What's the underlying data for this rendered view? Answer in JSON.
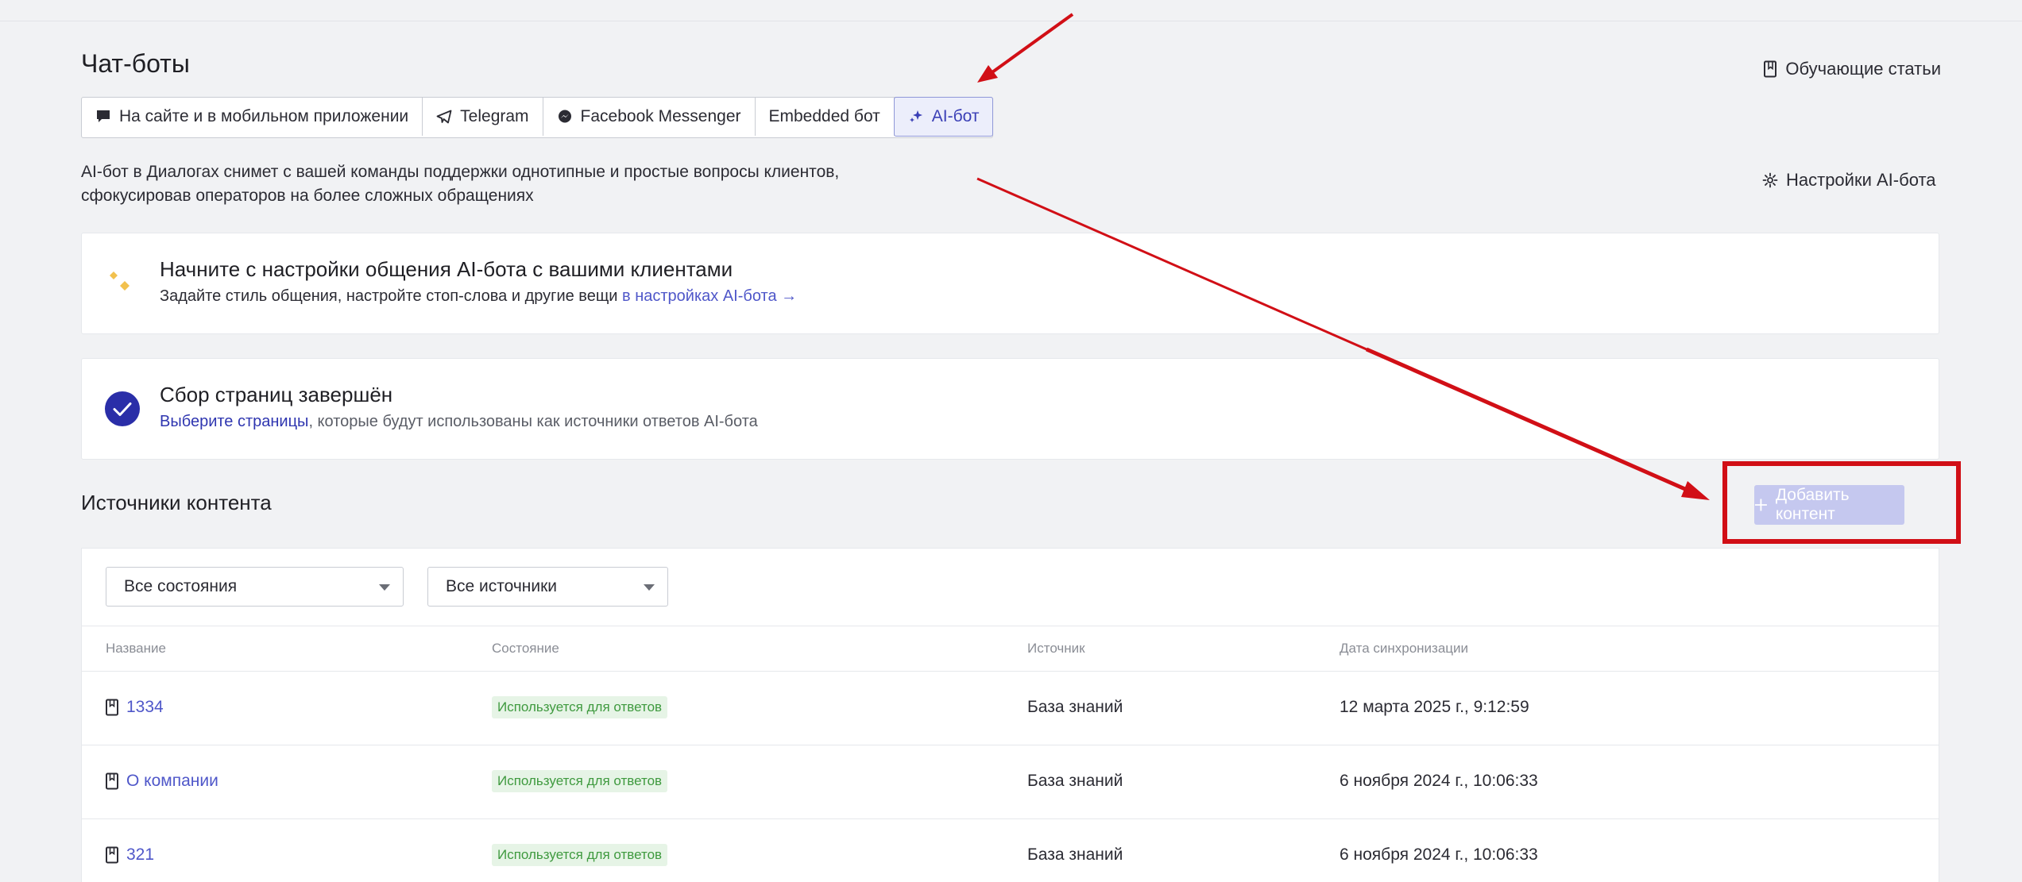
{
  "header": {
    "title": "Чат-боты",
    "tutorials_label": "Обучающие статьи"
  },
  "tabs": [
    {
      "label": "На сайте и в мобильном приложении",
      "icon": "chat-bubble-icon"
    },
    {
      "label": "Telegram",
      "icon": "telegram-icon"
    },
    {
      "label": "Facebook Messenger",
      "icon": "messenger-icon"
    },
    {
      "label": "Embedded бот",
      "icon": ""
    },
    {
      "label": "AI-бот",
      "icon": "sparkles-icon",
      "active": true
    }
  ],
  "intro": {
    "line1": "AI-бот в Диалогах снимет с вашей команды поддержки однотипные и простые вопросы клиентов,",
    "line2": "сфокусировав операторов на более сложных обращениях",
    "settings_label": "Настройки AI-бота"
  },
  "setup_card": {
    "title": "Начните с настройки общения AI-бота с вашими клиентами",
    "text": "Задайте стиль общения, настройте стоп-слова и другие вещи ",
    "link": "в настройках AI-бота →"
  },
  "collection_card": {
    "title": "Сбор страниц завершён",
    "link": "Выберите страницы",
    "text": ", которые будут использованы как источники ответов AI-бота"
  },
  "content_sources": {
    "title": "Источники контента",
    "add_button": "Добавить контент"
  },
  "filters": {
    "states": "Все состояния",
    "sources": "Все источники"
  },
  "table": {
    "columns": [
      "Название",
      "Состояние",
      "Источник",
      "Дата синхронизации"
    ],
    "rows": [
      {
        "name": "1334",
        "status": "Используется для ответов",
        "source": "База знаний",
        "date": "12 марта 2025 г., 9:12:59"
      },
      {
        "name": "О компании",
        "status": "Используется для ответов",
        "source": "База знаний",
        "date": "6 ноября 2024 г., 10:06:33"
      },
      {
        "name": "321",
        "status": "Используется для ответов",
        "source": "База знаний",
        "date": "6 ноября 2024 г., 10:06:33"
      }
    ]
  },
  "colors": {
    "accent": "#4f57c9",
    "annotation_red": "#d10f16",
    "badge_green": "#3f9a3f"
  }
}
